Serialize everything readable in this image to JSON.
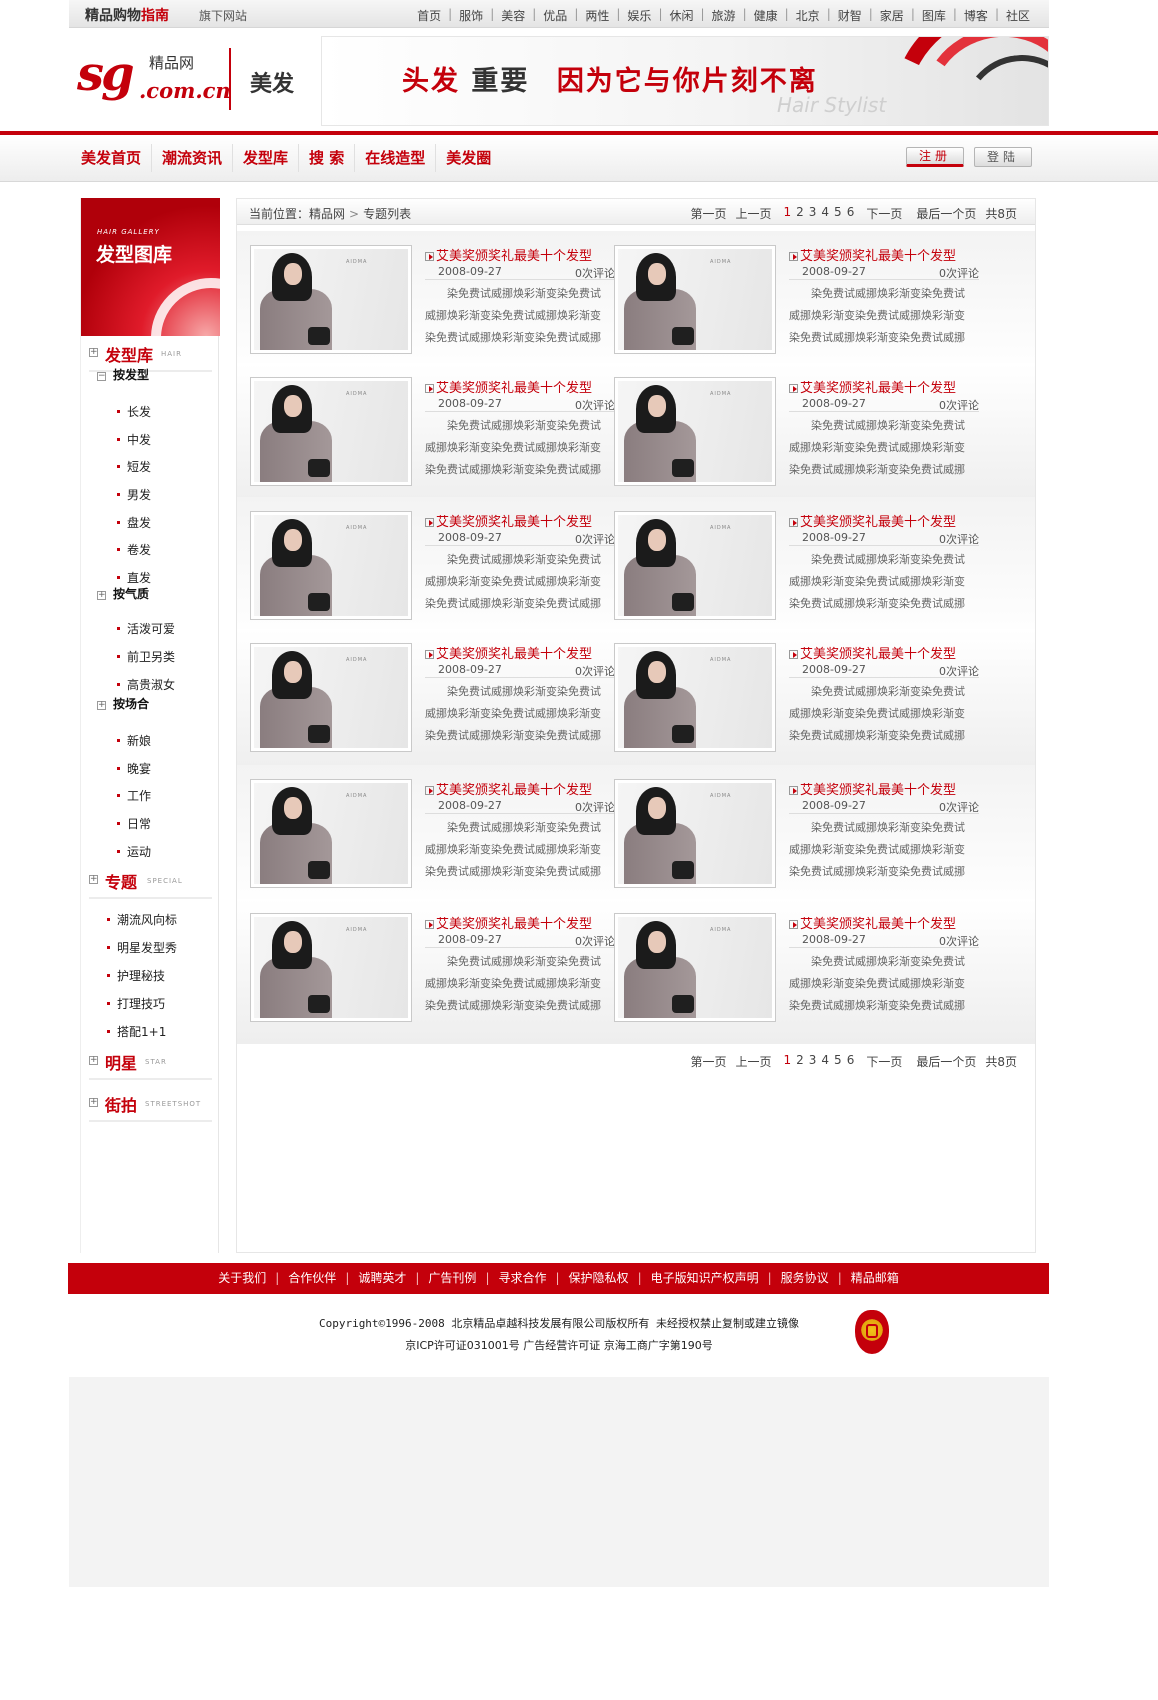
{
  "topbar": {
    "brand_main": "精品购物",
    "brand_accent": "指南",
    "subsite": "旗下网站",
    "nav": [
      "首页",
      "服饰",
      "美容",
      "优品",
      "两性",
      "娱乐",
      "休闲",
      "旅游",
      "健康",
      "北京",
      "财智",
      "家居",
      "图库",
      "博客",
      "社区"
    ]
  },
  "header": {
    "logo_mark": "sg",
    "logo_name": "精品网",
    "logo_domain": ".com.cn",
    "section_title": "美发",
    "banner": {
      "slogan_red1": "头发",
      "slogan_dark": "重要",
      "slogan_red2": "因为它与你片刻不离",
      "slogan_en": "Hair Stylist"
    }
  },
  "mainnav": {
    "items": [
      "美发首页",
      "潮流资讯",
      "发型库",
      "搜 索",
      "在线造型",
      "美发圈"
    ],
    "register": "注册",
    "login": "登陆"
  },
  "sidebar": {
    "header_en": "HAIR GALLERY",
    "header_cn": "发型图库",
    "sections": [
      {
        "cn": "发型库",
        "en": "HAIR"
      },
      {
        "cn": "专题",
        "en": "SPECIAL"
      },
      {
        "cn": "明星",
        "en": "STAR"
      },
      {
        "cn": "街拍",
        "en": "STREETSHOT"
      }
    ],
    "groups": [
      {
        "label": "按发型",
        "items": [
          "长发",
          "中发",
          "短发",
          "男发",
          "盘发",
          "卷发",
          "直发"
        ]
      },
      {
        "label": "按气质",
        "items": [
          "活泼可爱",
          "前卫另类",
          "高贵淑女"
        ]
      },
      {
        "label": "按场合",
        "items": [
          "新娘",
          "晚宴",
          "工作",
          "日常",
          "运动"
        ]
      }
    ],
    "special_items": [
      "潮流风向标",
      "明星发型秀",
      "护理秘技",
      "打理技巧",
      "搭配1+1"
    ]
  },
  "breadcrumb": {
    "label": "当前位置：",
    "site": "精品网",
    "arrow": ">",
    "current": "专题列表"
  },
  "pager": {
    "first": "第一页",
    "prev": "上一页",
    "pages": [
      "1",
      "2",
      "3",
      "4",
      "5",
      "6"
    ],
    "current": "1",
    "next": "下一页",
    "last": "最后一个页",
    "total": "共8页"
  },
  "article": {
    "title": "艾美奖颁奖礼最美十个发型",
    "date": "2008-09-27",
    "comments": "0次评论",
    "desc_line1": "染免费试威挪焕彩渐变染免费试",
    "desc_line2": "威挪焕彩渐变染免费试威挪焕彩渐变",
    "desc_line3": "染免费试威挪焕彩渐变染免费试威挪",
    "image_brand": "AIDMA"
  },
  "footer": {
    "links": [
      "关于我们",
      "合作伙伴",
      "诚聘英才",
      "广告刊例",
      "寻求合作",
      "保护隐私权",
      "电子版知识产权声明",
      "服务协议",
      "精品邮箱"
    ],
    "copyright": "Copyright©1996-2008 北京精品卓越科技发展有限公司版权所有  未经授权禁止复制或建立镜像",
    "license": "京ICP许可证031001号   广告经营许可证 京海工商广字第190号"
  },
  "colors": {
    "brand_red": "#c4000b",
    "text": "#333333",
    "muted": "#666666"
  }
}
